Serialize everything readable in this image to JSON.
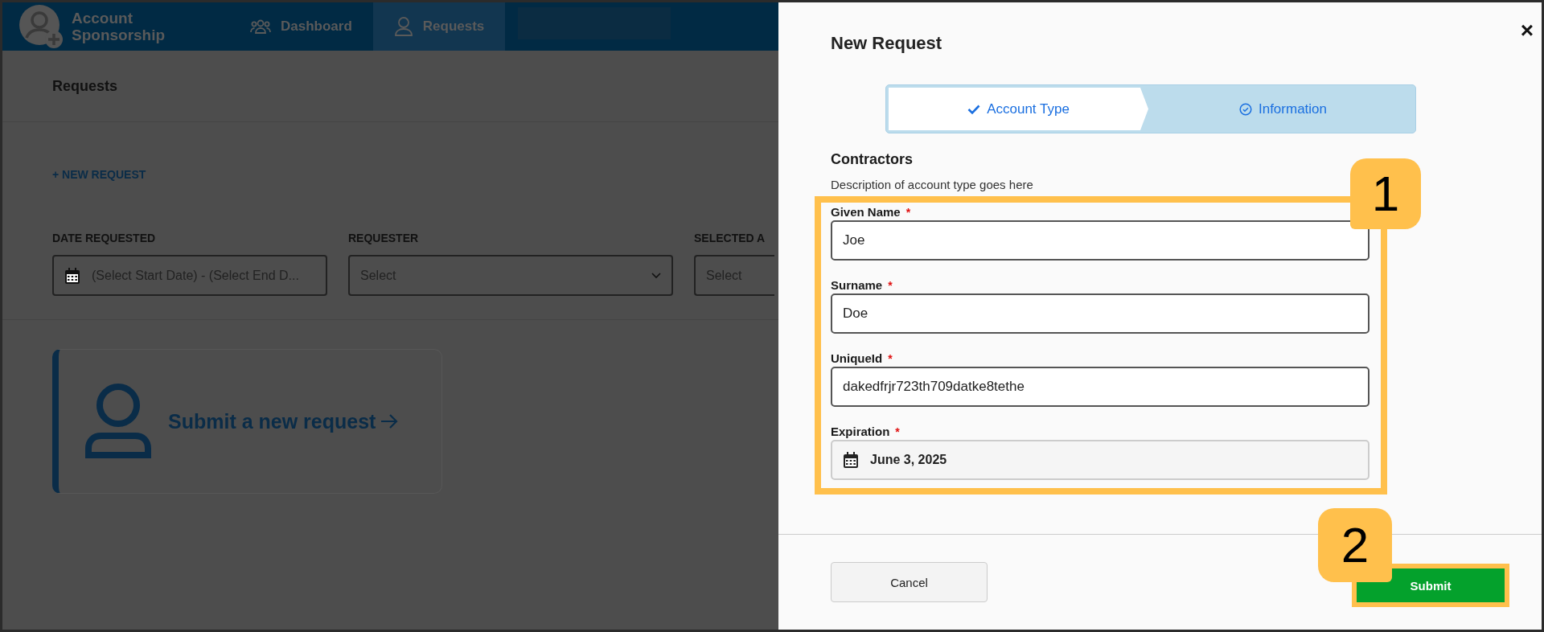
{
  "app": {
    "title": "Account Sponsorship",
    "nav": [
      {
        "label": "Dashboard",
        "selected": false
      },
      {
        "label": "Requests",
        "selected": true
      }
    ]
  },
  "page": {
    "heading": "Requests",
    "new_request_link": "+ NEW REQUEST",
    "filters": [
      {
        "label": "DATE REQUESTED",
        "kind": "date",
        "placeholder": "(Select Start Date) - (Select End D..."
      },
      {
        "label": "REQUESTER",
        "kind": "select",
        "placeholder": "Select"
      },
      {
        "label": "SELECTED A",
        "kind": "select",
        "placeholder": "Select"
      }
    ],
    "card": {
      "text": "Submit a new request"
    }
  },
  "dialog": {
    "title": "New Request",
    "close": "×",
    "steps": [
      {
        "label": "Account Type",
        "selected": false
      },
      {
        "label": "Information",
        "selected": true
      }
    ],
    "section_title": "Contractors",
    "description": "Description of account type goes here",
    "fields": [
      {
        "label": "Given Name",
        "required_mark": "*",
        "kind": "text",
        "value": "Joe"
      },
      {
        "label": "Surname",
        "required_mark": "*",
        "kind": "text",
        "value": "Doe"
      },
      {
        "label": "UniqueId",
        "required_mark": "*",
        "kind": "text",
        "value": "dakedfrjr723th709datke8tethe"
      },
      {
        "label": "Expiration",
        "required_mark": "*",
        "kind": "date",
        "value": "June 3, 2025"
      }
    ],
    "buttons": [
      {
        "label": "Cancel",
        "kind": "secondary"
      },
      {
        "label": "Submit",
        "kind": "primary"
      }
    ]
  },
  "annotations": [
    {
      "label": "1"
    },
    {
      "label": "2"
    }
  ]
}
